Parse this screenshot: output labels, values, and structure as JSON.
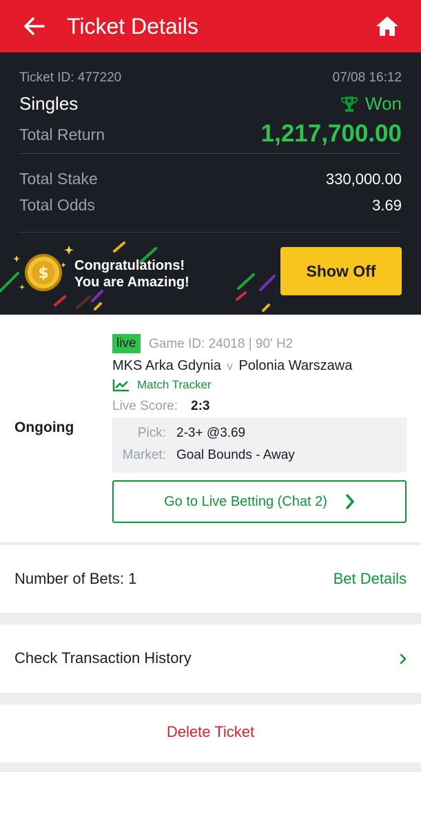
{
  "header": {
    "title": "Ticket Details",
    "back_icon": "arrow-left-icon",
    "home_icon": "home-icon",
    "bg_color": "#e41b2a"
  },
  "ticket": {
    "id_label": "Ticket ID: 477220",
    "datetime": "07/08 16:12",
    "type": "Singles",
    "status": "Won",
    "status_icon": "trophy-icon",
    "total_return_label": "Total Return",
    "total_return_value": "1,217,700.00",
    "total_stake_label": "Total Stake",
    "total_stake_value": "330,000.00",
    "total_odds_label": "Total Odds",
    "total_odds_value": "3.69"
  },
  "banner": {
    "line1": "Congratulations!",
    "line2": "You are Amazing!",
    "button_label": "Show Off",
    "accent_color": "#f7c51d"
  },
  "event": {
    "state": "Ongoing",
    "live_badge": "live",
    "game_info": "Game ID: 24018 | 90' H2",
    "home_team": "MKS Arka Gdynia",
    "vs": "v",
    "away_team": "Polonia Warszawa",
    "tracker_label": "Match Tracker",
    "live_score_label": "Live Score:",
    "live_score_value": "2:3",
    "pick_label": "Pick:",
    "pick_value": "2-3+ @3.69",
    "market_label": "Market:",
    "market_value": "Goal Bounds - Away",
    "live_betting_button": "Go to Live Betting (Chat 2)"
  },
  "bets": {
    "count_label": "Number of Bets: 1",
    "details_link": "Bet Details"
  },
  "history": {
    "label": "Check Transaction History"
  },
  "delete": {
    "label": "Delete Ticket"
  },
  "colors": {
    "green": "#2fc34b",
    "dark_green": "#0d9737",
    "red": "#e41b2a",
    "dark_bg": "#1b1e25"
  }
}
